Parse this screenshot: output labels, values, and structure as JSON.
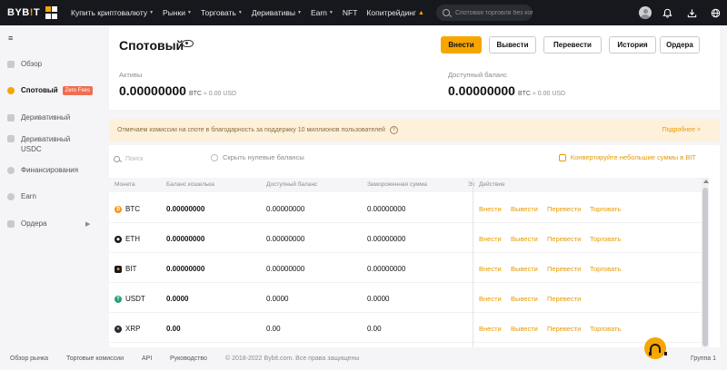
{
  "brand": {
    "logo_left": "BYB",
    "logo_mid": "!",
    "logo_right": "T"
  },
  "nav": {
    "items": [
      {
        "label": "Купить криптовалюту",
        "caret": "▼"
      },
      {
        "label": "Рынки",
        "caret": "▼"
      },
      {
        "label": "Торговать",
        "caret": "▼"
      },
      {
        "label": "Деривативы",
        "caret": "▼"
      },
      {
        "label": "Earn",
        "caret": "▼"
      },
      {
        "label": "NFT",
        "caret": ""
      },
      {
        "label": "Копитрейдинг",
        "caret": ""
      }
    ],
    "search_placeholder": "Спотовая торговля без ком",
    "icons": [
      "avatar",
      "bell-icon",
      "download-icon",
      "globe-icon"
    ]
  },
  "sidebar": {
    "items": [
      {
        "label": "Обзор"
      },
      {
        "label": "Спотовый",
        "badge": "Zero Fees"
      },
      {
        "label": "Деривативный"
      },
      {
        "label": "Деривативный USDC"
      },
      {
        "label": "Финансирования"
      },
      {
        "label": "Earn"
      },
      {
        "label": "Ордера"
      }
    ]
  },
  "header": {
    "title": "Спотовый",
    "buttons": {
      "deposit": "Внести",
      "withdraw": "Вывести",
      "transfer": "Перевести",
      "history": "История",
      "orders": "Ордера"
    },
    "assets_label": "Активы",
    "assets_value": "0.00000000",
    "assets_unit": "BTC",
    "assets_usd": "≈ 0.00 USD",
    "available_label": "Доступный баланс",
    "available_value": "0.00000000",
    "available_unit": "BTC",
    "available_usd": "≈ 0.00 USD"
  },
  "banner": {
    "text": "Отмечаем комиссии на споте в благодарность за поддержку 10 миллионов пользователей",
    "info": "?",
    "more": "Подробнее >"
  },
  "table": {
    "search_placeholder": "Поиск",
    "hide_zero": "Скрыть нулевые балансы",
    "convert": "Конвертируйте небольшие суммы в BIT",
    "headers": [
      "Монета",
      "Баланс кошелька",
      "Доступный баланс",
      "Замороженная сумма",
      "Эк",
      "Действие"
    ],
    "actions": {
      "deposit": "Внести",
      "withdraw": "Вывести",
      "transfer": "Перевести",
      "trade": "Торговать"
    },
    "rows": [
      {
        "coin": "BTC",
        "wallet": "0.00000000",
        "available": "0.00000000",
        "frozen": "0.00000000",
        "trade": true,
        "color": "#f7931a"
      },
      {
        "coin": "ETH",
        "wallet": "0.00000000",
        "available": "0.00000000",
        "frozen": "0.00000000",
        "trade": true,
        "color": "#17181e"
      },
      {
        "coin": "BIT",
        "wallet": "0.00000000",
        "available": "0.00000000",
        "frozen": "0.00000000",
        "trade": true,
        "color": "#17181e"
      },
      {
        "coin": "USDT",
        "wallet": "0.0000",
        "available": "0.0000",
        "frozen": "0.0000",
        "trade": false,
        "color": "#26a17b"
      },
      {
        "coin": "XRP",
        "wallet": "0.00",
        "available": "0.00",
        "frozen": "0.00",
        "trade": true,
        "color": "#23292f"
      }
    ]
  },
  "footer": {
    "links": [
      "Обзор рынка",
      "Торговые комиссии",
      "API",
      "Руководство"
    ],
    "copyright": "© 2018-2022 Bybit.com. Все права защищены",
    "page": "Группа 1"
  },
  "colors": {
    "accent": "#f7a600",
    "nav_bg": "#17181e",
    "badge": "#ef6e52"
  }
}
